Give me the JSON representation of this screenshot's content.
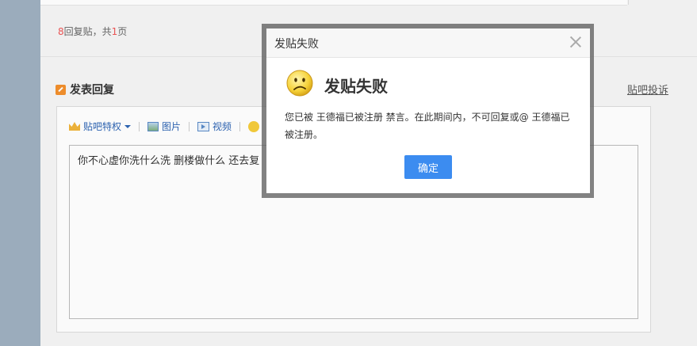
{
  "thread": {
    "reply_count": "8",
    "reply_text_mid": "回复贴，共",
    "page_count": "1",
    "reply_text_end": "页"
  },
  "reply_section": {
    "title": "发表回复",
    "complain_link": "贴吧投诉"
  },
  "toolbar": {
    "privilege_label": "贴吧特权",
    "image_label": "图片",
    "video_label": "视频"
  },
  "editor": {
    "content": "你不心虚你洗什么洗 删楼做什么 还去复"
  },
  "dialog": {
    "title": "发贴失败",
    "heading": "发贴失败",
    "message": "您已被 王德福已被注册 禁言。在此期间内，不可回复或@ 王德福已被注册。",
    "confirm_label": "确定"
  }
}
